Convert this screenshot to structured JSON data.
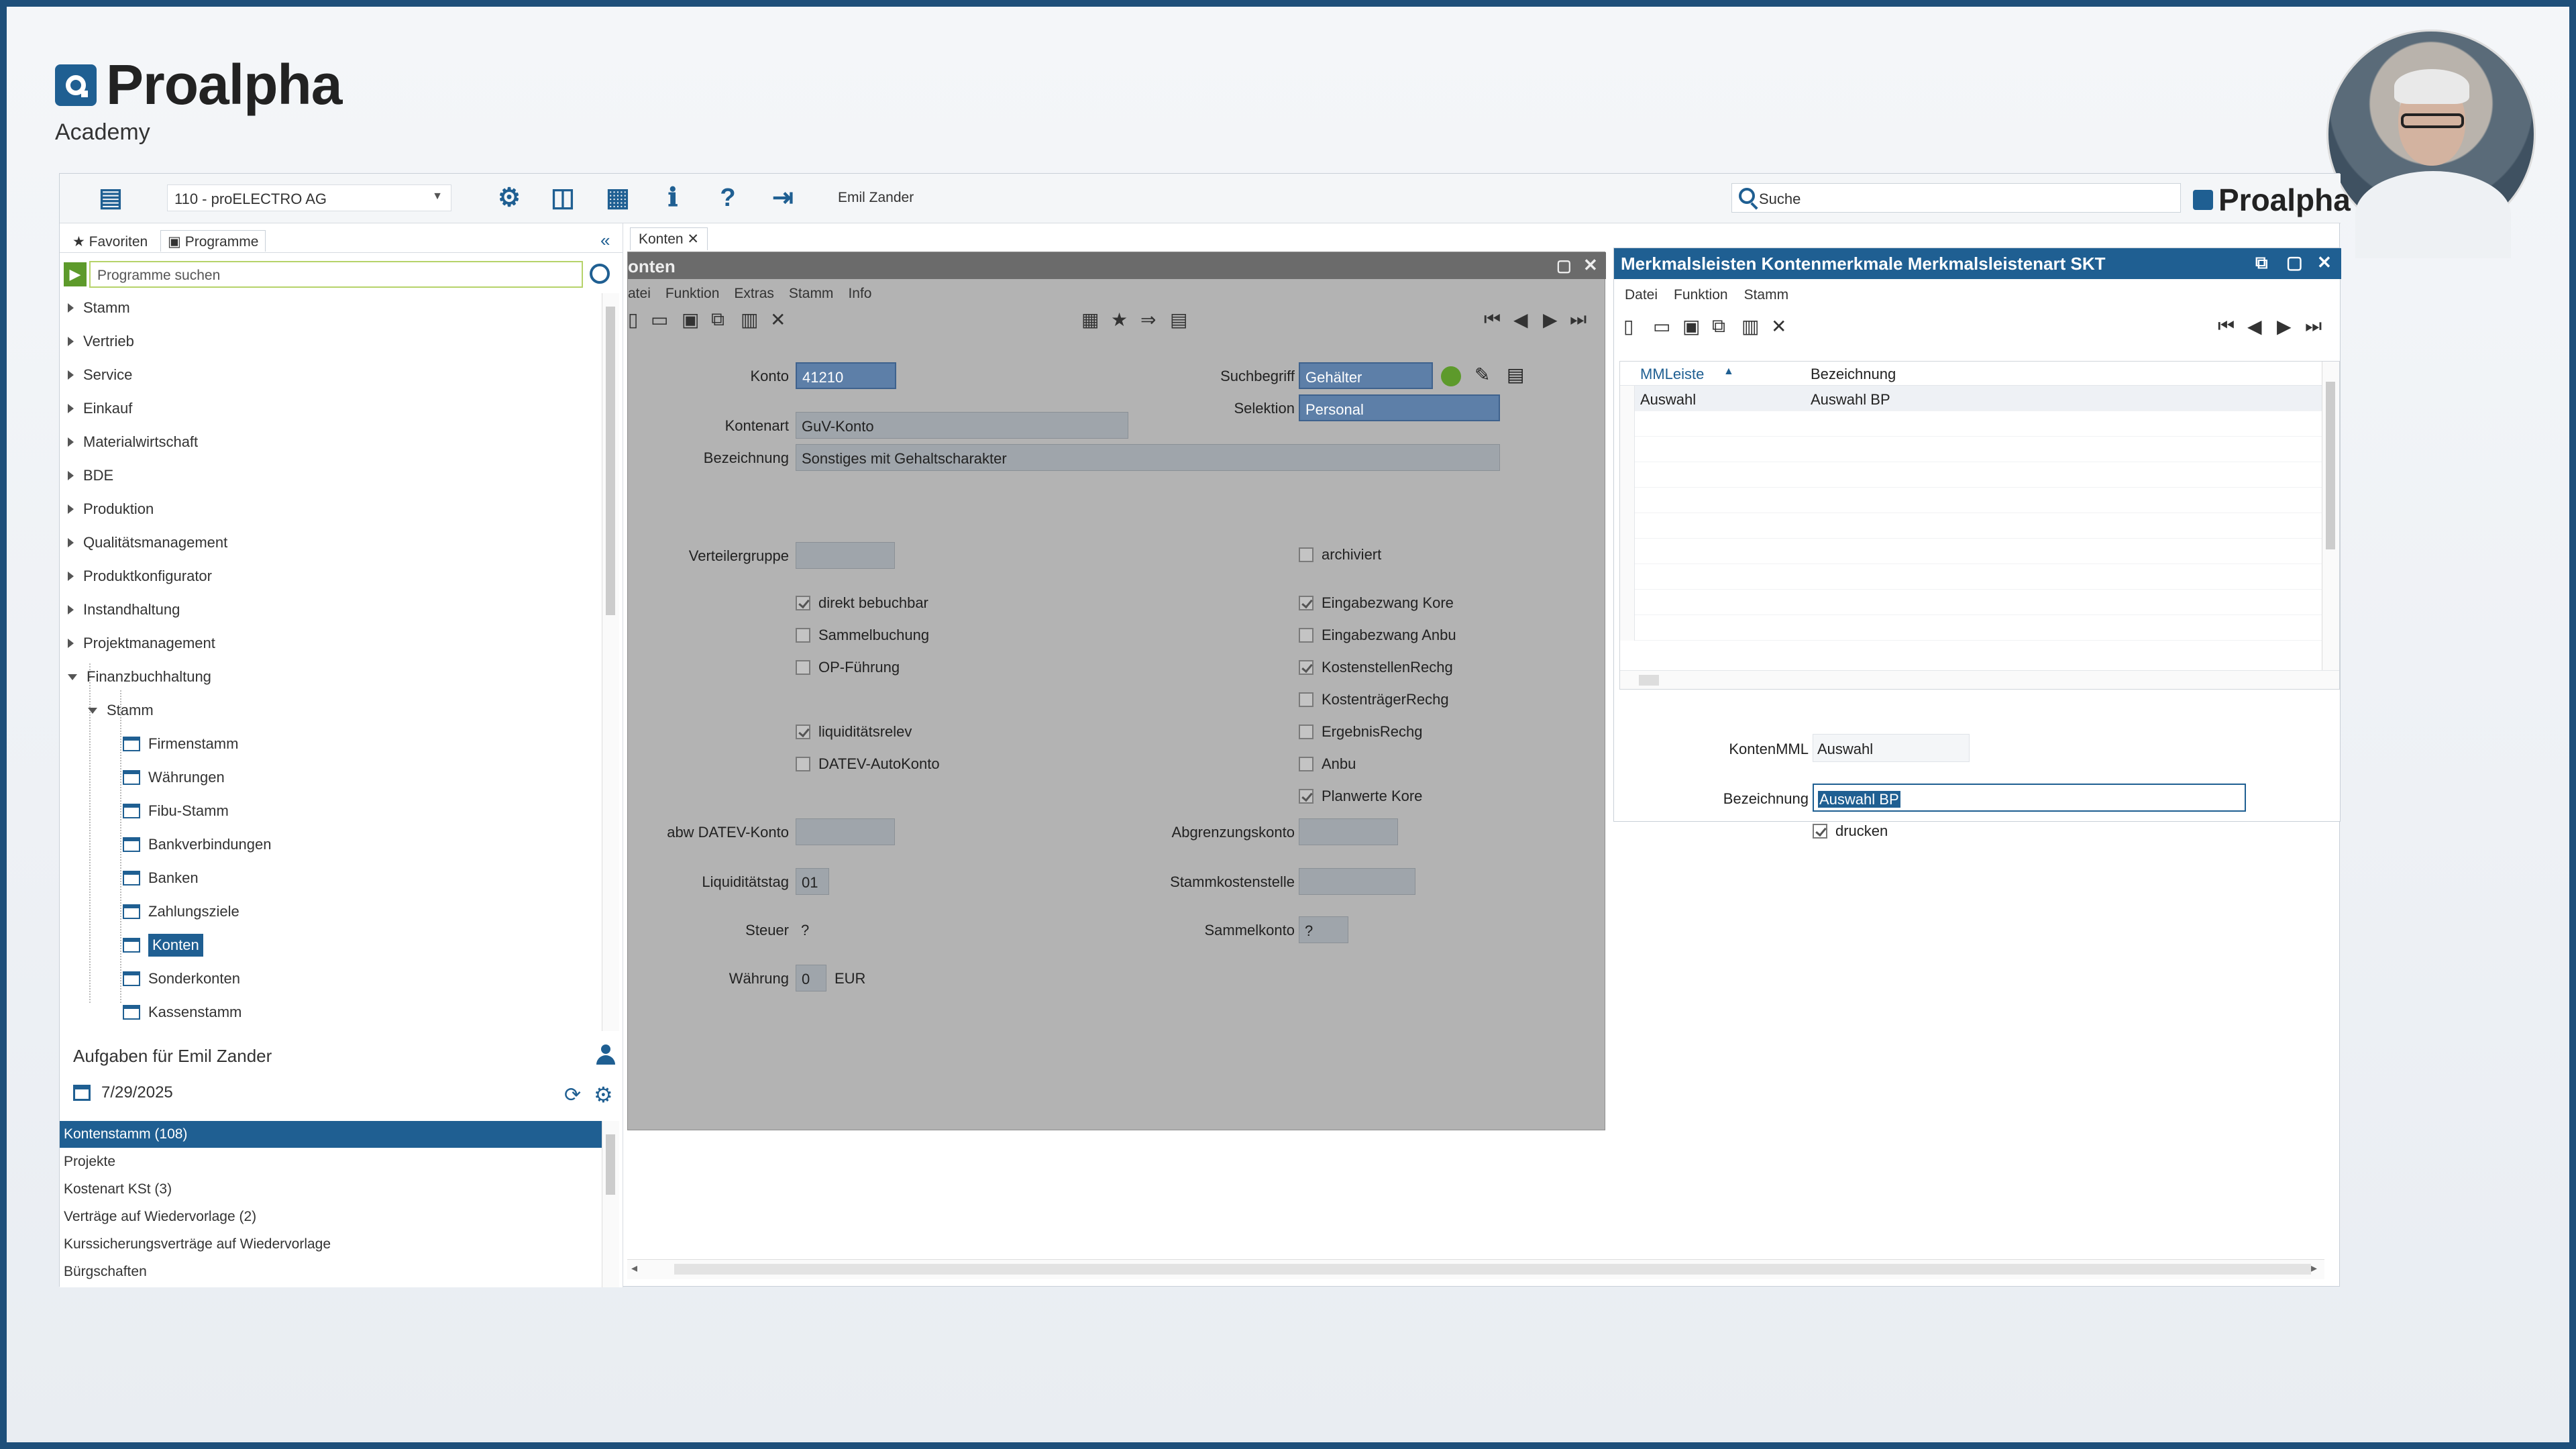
{
  "brand": {
    "name": "Proalpha",
    "subtitle": "Academy"
  },
  "toolbar": {
    "company": "110 - proELECTRO AG",
    "user": "Emil Zander",
    "search_placeholder": "Suche",
    "logo_text": "Proalpha"
  },
  "left_panel": {
    "tabs": [
      "Favoriten",
      "Programme"
    ],
    "search_placeholder": "Programme suchen",
    "tree": [
      {
        "label": "Stamm"
      },
      {
        "label": "Vertrieb"
      },
      {
        "label": "Service"
      },
      {
        "label": "Einkauf"
      },
      {
        "label": "Materialwirtschaft"
      },
      {
        "label": "BDE"
      },
      {
        "label": "Produktion"
      },
      {
        "label": "Qualitätsmanagement"
      },
      {
        "label": "Produktkonfigurator"
      },
      {
        "label": "Instandhaltung"
      },
      {
        "label": "Projektmanagement"
      },
      {
        "label": "Finanzbuchhaltung"
      },
      {
        "label": "Stamm"
      },
      {
        "label": "Firmenstamm"
      },
      {
        "label": "Währungen"
      },
      {
        "label": "Fibu-Stamm"
      },
      {
        "label": "Bankverbindungen"
      },
      {
        "label": "Banken"
      },
      {
        "label": "Zahlungsziele"
      },
      {
        "label": "Konten"
      },
      {
        "label": "Sonderkonten"
      },
      {
        "label": "Kassenstamm"
      }
    ],
    "tasks_title": "Aufgaben für Emil Zander",
    "tasks_date": "7/29/2025",
    "tasks": [
      "Kontenstamm (108)",
      "Projekte",
      "Kostenart KSt (3)",
      "Verträge auf Wiedervorlage (2)",
      "Kurssicherungsverträge auf Wiedervorlage",
      "Bürgschaften"
    ]
  },
  "konten": {
    "tab_label": "Konten",
    "title": "onten",
    "menu": [
      "atei",
      "Funktion",
      "Extras",
      "Stamm",
      "Info"
    ],
    "fields": {
      "konto_label": "Konto",
      "konto": "41210",
      "suchbegriff_label": "Suchbegriff",
      "suchbegriff": "Gehälter",
      "selektion_label": "Selektion",
      "selektion": "Personal",
      "kontenart_label": "Kontenart",
      "kontenart": "GuV-Konto",
      "bezeichnung_label": "Bezeichnung",
      "bezeichnung": "Sonstiges mit Gehaltscharakter",
      "verteilergruppe_label": "Verteilergruppe",
      "verteilergruppe": "",
      "abw_datev_label": "abw DATEV-Konto",
      "abw_datev": "",
      "liquiditaetstag_label": "Liquiditätstag",
      "liquiditaetstag": "01",
      "steuer_label": "Steuer",
      "steuer": "?",
      "waehrung_label": "Währung",
      "waehrung_code": "0",
      "waehrung": "EUR",
      "abgrenzungskonto_label": "Abgrenzungskonto",
      "abgrenzungskonto": "",
      "stammkostenstelle_label": "Stammkostenstelle",
      "stammkostenstelle": "",
      "sammelkonto_label": "Sammelkonto",
      "sammelkonto": "?"
    },
    "checks_left": [
      {
        "label": "direkt bebuchbar",
        "checked": true
      },
      {
        "label": "Sammelbuchung",
        "checked": false
      },
      {
        "label": "OP-Führung",
        "checked": false
      },
      {
        "label": "liquiditätsrelev",
        "checked": true
      },
      {
        "label": "DATEV-AutoKonto",
        "checked": false
      }
    ],
    "checks_right": [
      {
        "label": "archiviert",
        "checked": false
      },
      {
        "label": "Eingabezwang Kore",
        "checked": true
      },
      {
        "label": "Eingabezwang Anbu",
        "checked": false
      },
      {
        "label": "KostenstellenRechg",
        "checked": true
      },
      {
        "label": "KostenträgerRechg",
        "checked": false
      },
      {
        "label": "ErgebnisRechg",
        "checked": false
      },
      {
        "label": "Anbu",
        "checked": false
      },
      {
        "label": "Planwerte Kore",
        "checked": true
      }
    ]
  },
  "mml": {
    "title": "Merkmalsleisten Kontenmerkmale Merkmalsleistenart SKT",
    "menu": [
      "Datei",
      "Funktion",
      "Stamm"
    ],
    "columns": [
      "MMLeiste",
      "Bezeichnung"
    ],
    "rows": [
      {
        "mml": "Auswahl",
        "bez": "Auswahl BP"
      }
    ],
    "kontenmml_label": "KontenMML",
    "kontenmml": "Auswahl",
    "bezeichnung_label": "Bezeichnung",
    "bezeichnung": "Auswahl BP",
    "drucken_label": "drucken",
    "drucken": true
  },
  "colors": {
    "accent": "#1f5f92",
    "green": "#5d9a2b",
    "field_dark": "#9fa5ab"
  }
}
